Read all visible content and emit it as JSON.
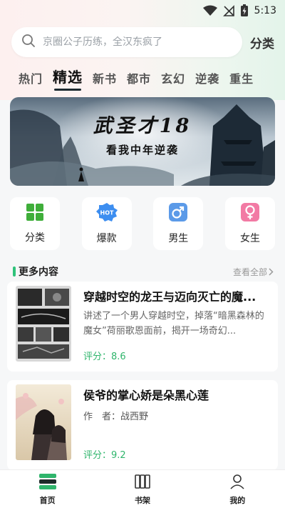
{
  "status_bar": {
    "time": "5:13"
  },
  "search": {
    "placeholder": "京圈公子历练，全汉东疯了",
    "category_label": "分类"
  },
  "tabs": [
    {
      "label": "热门"
    },
    {
      "label": "精选"
    },
    {
      "label": "新书"
    },
    {
      "label": "都市"
    },
    {
      "label": "玄幻"
    },
    {
      "label": "逆袭"
    },
    {
      "label": "重生"
    }
  ],
  "active_tab": "精选",
  "banner": {
    "title": "武圣才18",
    "subtitle": "看我中年逆袭"
  },
  "quick_entries": [
    {
      "label": "分类",
      "icon": "grid-icon",
      "color": "#3fae3a"
    },
    {
      "label": "爆款",
      "icon": "hot-badge-icon",
      "color": "#3d8ef0",
      "badge": "HOT"
    },
    {
      "label": "男生",
      "icon": "male-icon",
      "color": "#4a8fe0"
    },
    {
      "label": "女生",
      "icon": "female-icon",
      "color": "#f0689a"
    }
  ],
  "section": {
    "title": "更多内容",
    "view_all": "查看全部"
  },
  "books": [
    {
      "title": "穿越时空的龙王与迈向灭亡的魔...",
      "description": "讲述了一个男人穿越时空，掉落“暗黑森林的魔女”荷丽歌恩面前，揭开一场奇幻...",
      "score": "评分：8.6"
    },
    {
      "title": "侯爷的掌心娇是朵黑心莲",
      "author": "作　者：战西野",
      "score": "评分：9.2"
    }
  ],
  "bottom_nav": [
    {
      "label": "首页",
      "icon": "home-books-icon"
    },
    {
      "label": "书架",
      "icon": "bookshelf-icon"
    },
    {
      "label": "我的",
      "icon": "user-icon"
    }
  ],
  "colors": {
    "accent_green": "#2fb56c",
    "active_tab_underline": "#1d2a30"
  }
}
